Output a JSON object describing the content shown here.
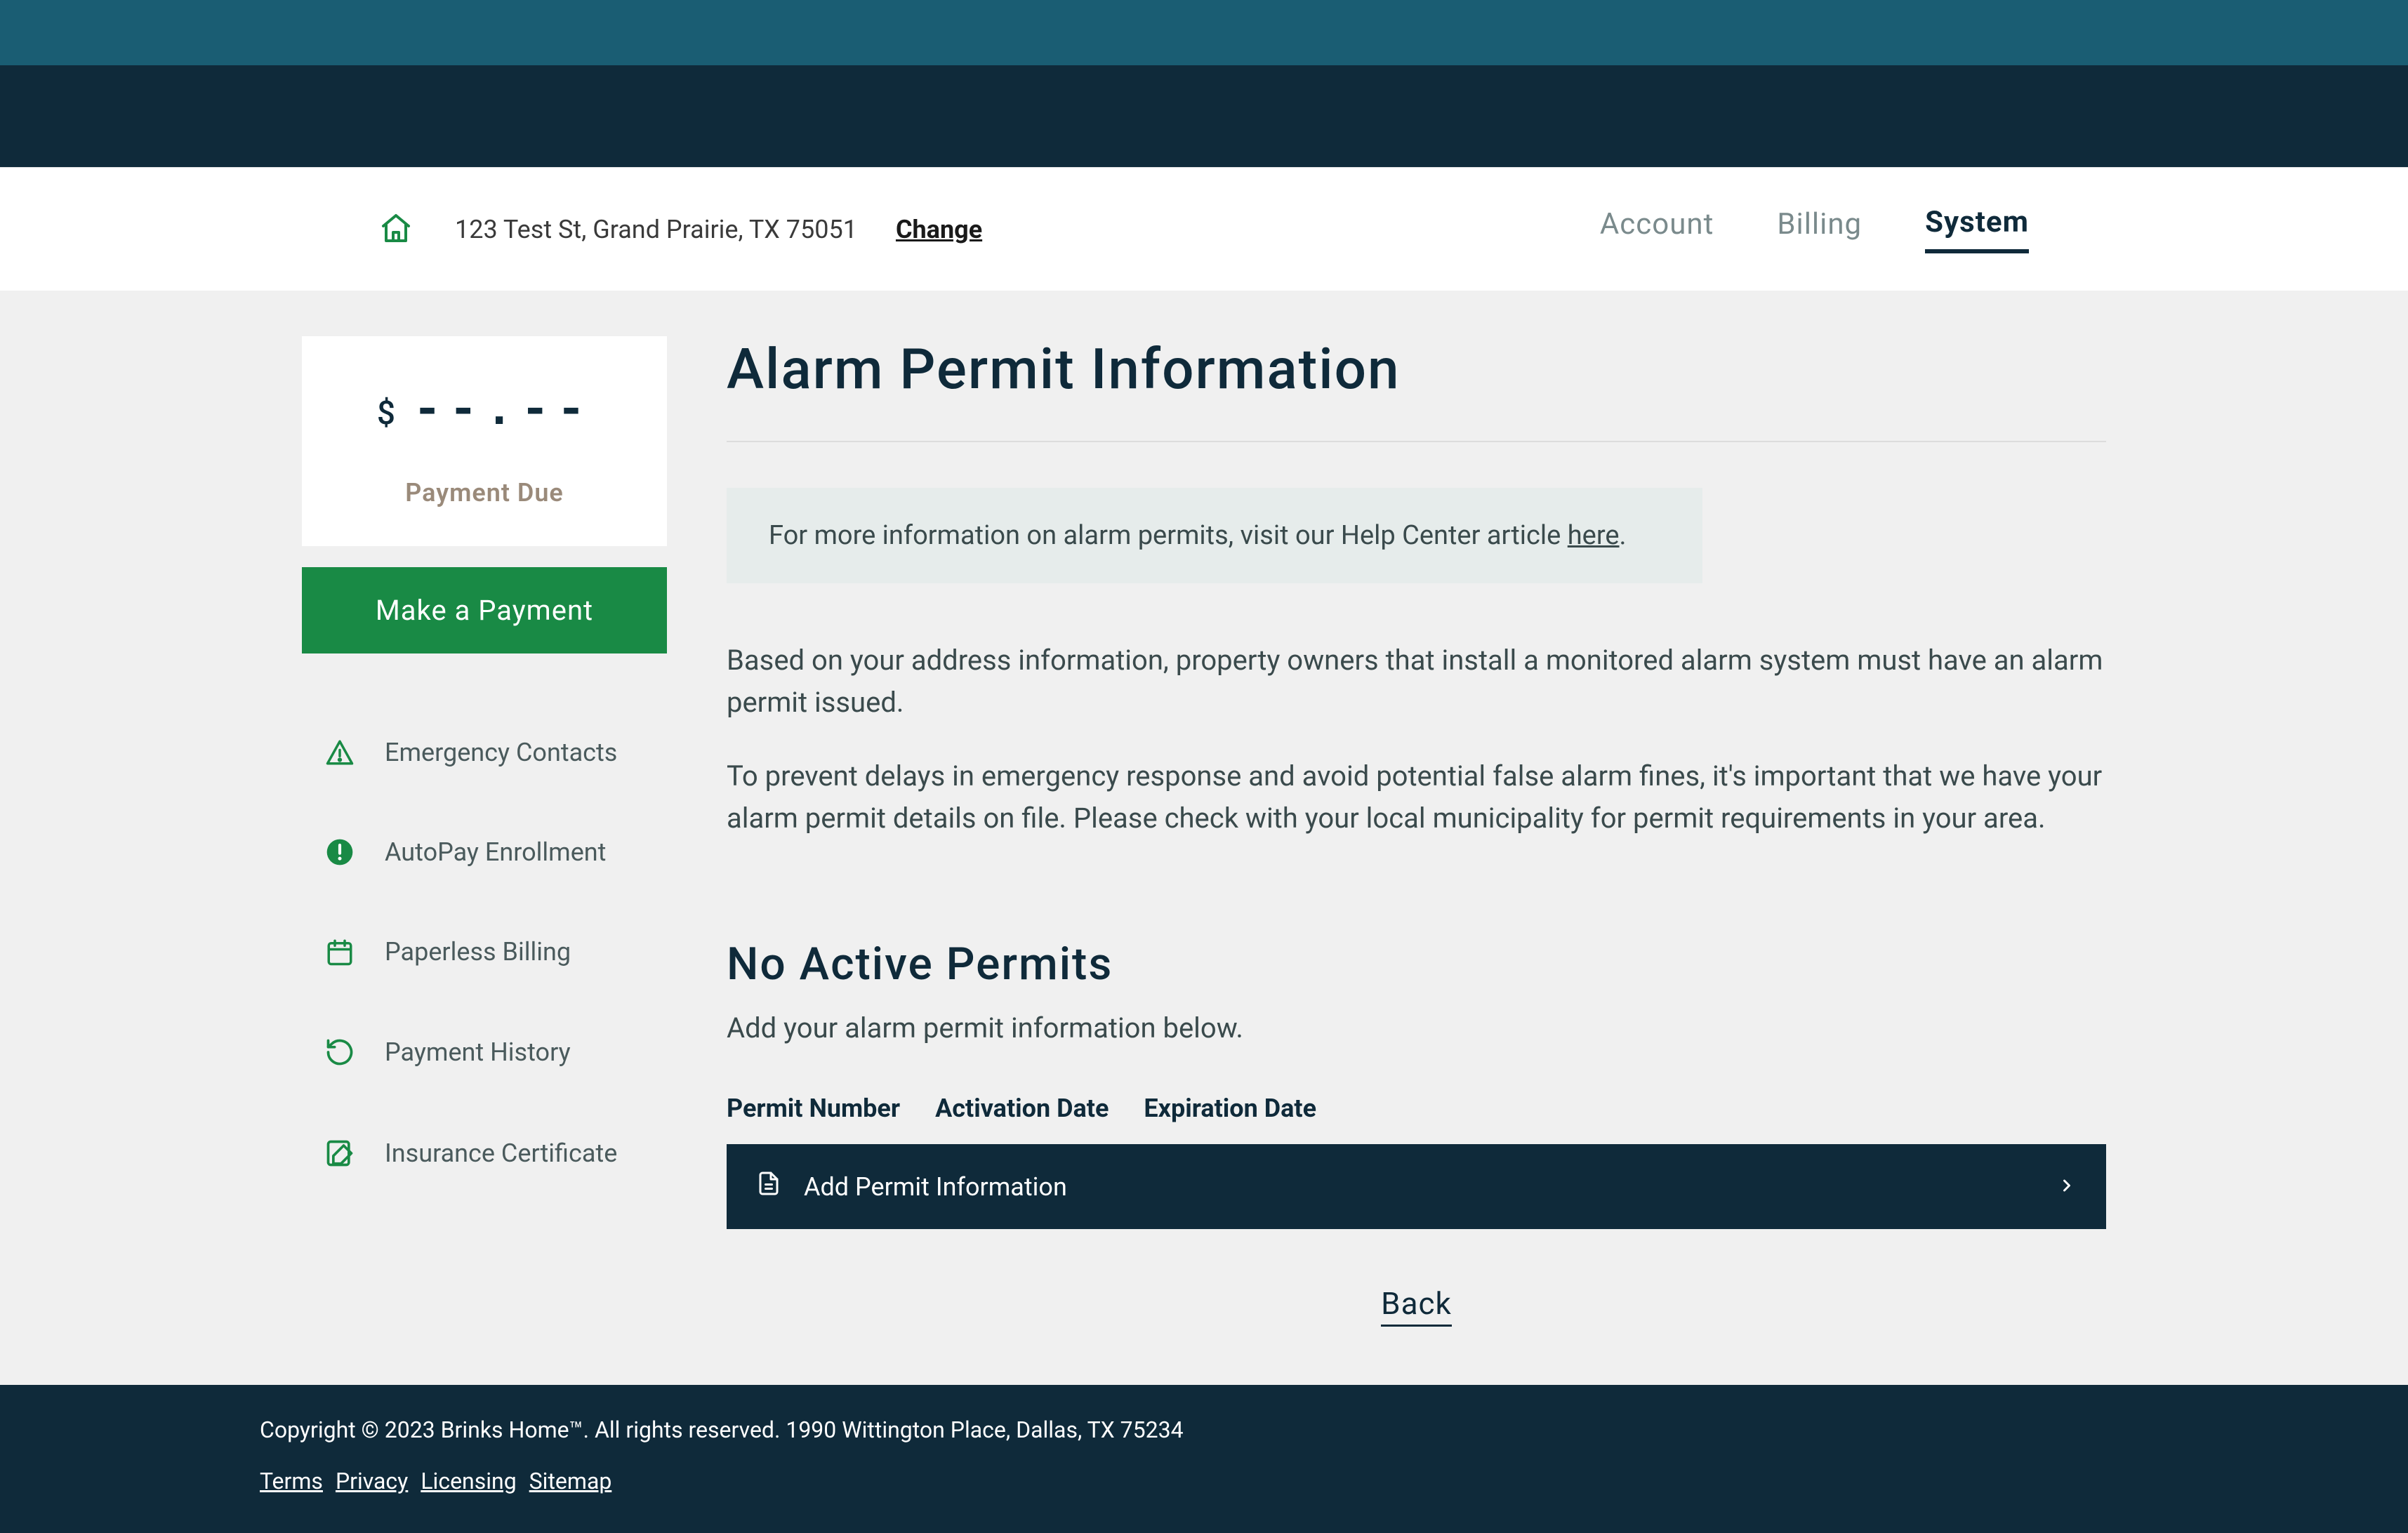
{
  "header": {
    "address": "123 Test St, Grand Prairie, TX 75051",
    "change_label": "Change",
    "tabs": [
      {
        "label": "Account",
        "active": false
      },
      {
        "label": "Billing",
        "active": false
      },
      {
        "label": "System",
        "active": true
      }
    ]
  },
  "sidebar": {
    "dollar_sign": "$",
    "amount": "--.--",
    "payment_due_label": "Payment Due",
    "make_payment_label": "Make a Payment",
    "items": [
      {
        "label": "Emergency Contacts",
        "icon": "warning"
      },
      {
        "label": "AutoPay Enrollment",
        "icon": "alert-circle"
      },
      {
        "label": "Paperless Billing",
        "icon": "calendar"
      },
      {
        "label": "Payment History",
        "icon": "history"
      },
      {
        "label": "Insurance Certificate",
        "icon": "edit-doc"
      }
    ]
  },
  "content": {
    "page_title": "Alarm Permit Information",
    "info_box_prefix": "For more information on alarm permits, visit our Help Center article ",
    "info_box_link": "here",
    "info_box_suffix": ".",
    "para1": "Based on your address information, property owners that install a monitored alarm system must have an alarm permit issued.",
    "para2": "To prevent delays in emergency response and avoid potential false alarm fines, it's important that we have your alarm permit details on file. Please check with your local municipality for permit requirements in your area.",
    "section_title": "No Active Permits",
    "section_sub": "Add your alarm permit information below.",
    "cols": {
      "permit_number": "Permit Number",
      "activation_date": "Activation Date",
      "expiration_date": "Expiration Date"
    },
    "add_row_label": "Add Permit Information",
    "back_label": "Back"
  },
  "footer": {
    "copyright": "Copyright © 2023 Brinks Home™. All rights reserved. 1990 Wittington Place, Dallas, TX 75234",
    "links": {
      "terms": "Terms",
      "privacy": "Privacy",
      "licensing": "Licensing",
      "sitemap": "Sitemap"
    }
  }
}
